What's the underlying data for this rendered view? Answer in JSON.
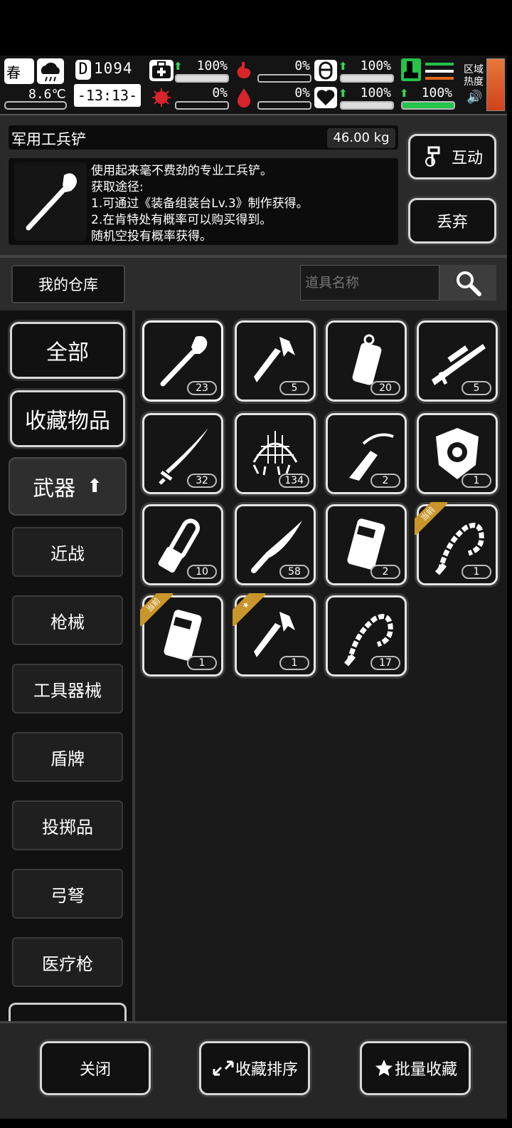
{
  "status": {
    "season": "春",
    "temperature": "8.6℃",
    "day": "1094",
    "day_prefix": "D",
    "time": "-13:13-",
    "health_pct": "100%",
    "infection_pct": "0%",
    "hunger_pct": "0%",
    "thirst_pct": "0%",
    "armor_pct": "100%",
    "mood_pct": "100%",
    "stamina_pct": "100%",
    "zone_heat_label_1": "区域",
    "zone_heat_label_2": "热度"
  },
  "item_detail": {
    "name": "军用工兵铲",
    "weight": "46.00 kg",
    "description_lines": [
      "使用起来毫不费劲的专业工兵铲。",
      "获取途径:",
      "1.可通过《装备组装台Lv.3》制作获得。",
      "2.在肯特处有概率可以购买得到。",
      "随机空投有概率获得。"
    ],
    "interact_label": "互动",
    "discard_label": "丢弃"
  },
  "warehouse": {
    "title": "我的仓库",
    "search_placeholder": "道具名称"
  },
  "categories": {
    "all": "全部",
    "favorites": "收藏物品",
    "weapons": "武器",
    "sub": [
      "近战",
      "枪械",
      "工具器械",
      "盾牌",
      "投掷品",
      "弓弩",
      "医疗枪"
    ]
  },
  "items": [
    {
      "icon": "shovel-icon",
      "count": "23",
      "badge": ""
    },
    {
      "icon": "hatchet-icon",
      "count": "5",
      "badge": ""
    },
    {
      "icon": "grenade-icon",
      "count": "20",
      "badge": ""
    },
    {
      "icon": "sniper-rifle-icon",
      "count": "5",
      "badge": ""
    },
    {
      "icon": "katana-icon",
      "count": "32",
      "badge": ""
    },
    {
      "icon": "net-icon",
      "count": "134",
      "badge": ""
    },
    {
      "icon": "crossbow-hand-icon",
      "count": "2",
      "badge": ""
    },
    {
      "icon": "shield-emblem-icon",
      "count": "1",
      "badge": ""
    },
    {
      "icon": "chainsaw-icon",
      "count": "10",
      "badge": ""
    },
    {
      "icon": "knife-icon",
      "count": "58",
      "badge": ""
    },
    {
      "icon": "riot-shield-icon",
      "count": "2",
      "badge": ""
    },
    {
      "icon": "whip-icon",
      "count": "1",
      "badge": "当前"
    },
    {
      "icon": "riot-shield-icon",
      "count": "1",
      "badge": "当前"
    },
    {
      "icon": "hatchet-icon",
      "count": "1",
      "badge": "★"
    },
    {
      "icon": "whip-icon",
      "count": "17",
      "badge": ""
    }
  ],
  "footer": {
    "close": "关闭",
    "sort_favorites": "收藏排序",
    "batch_favorite": "批量收藏"
  },
  "colors": {
    "badge_gold": "#c9962b",
    "stat_green": "#25c34a",
    "infection_red": "#d8242b"
  }
}
